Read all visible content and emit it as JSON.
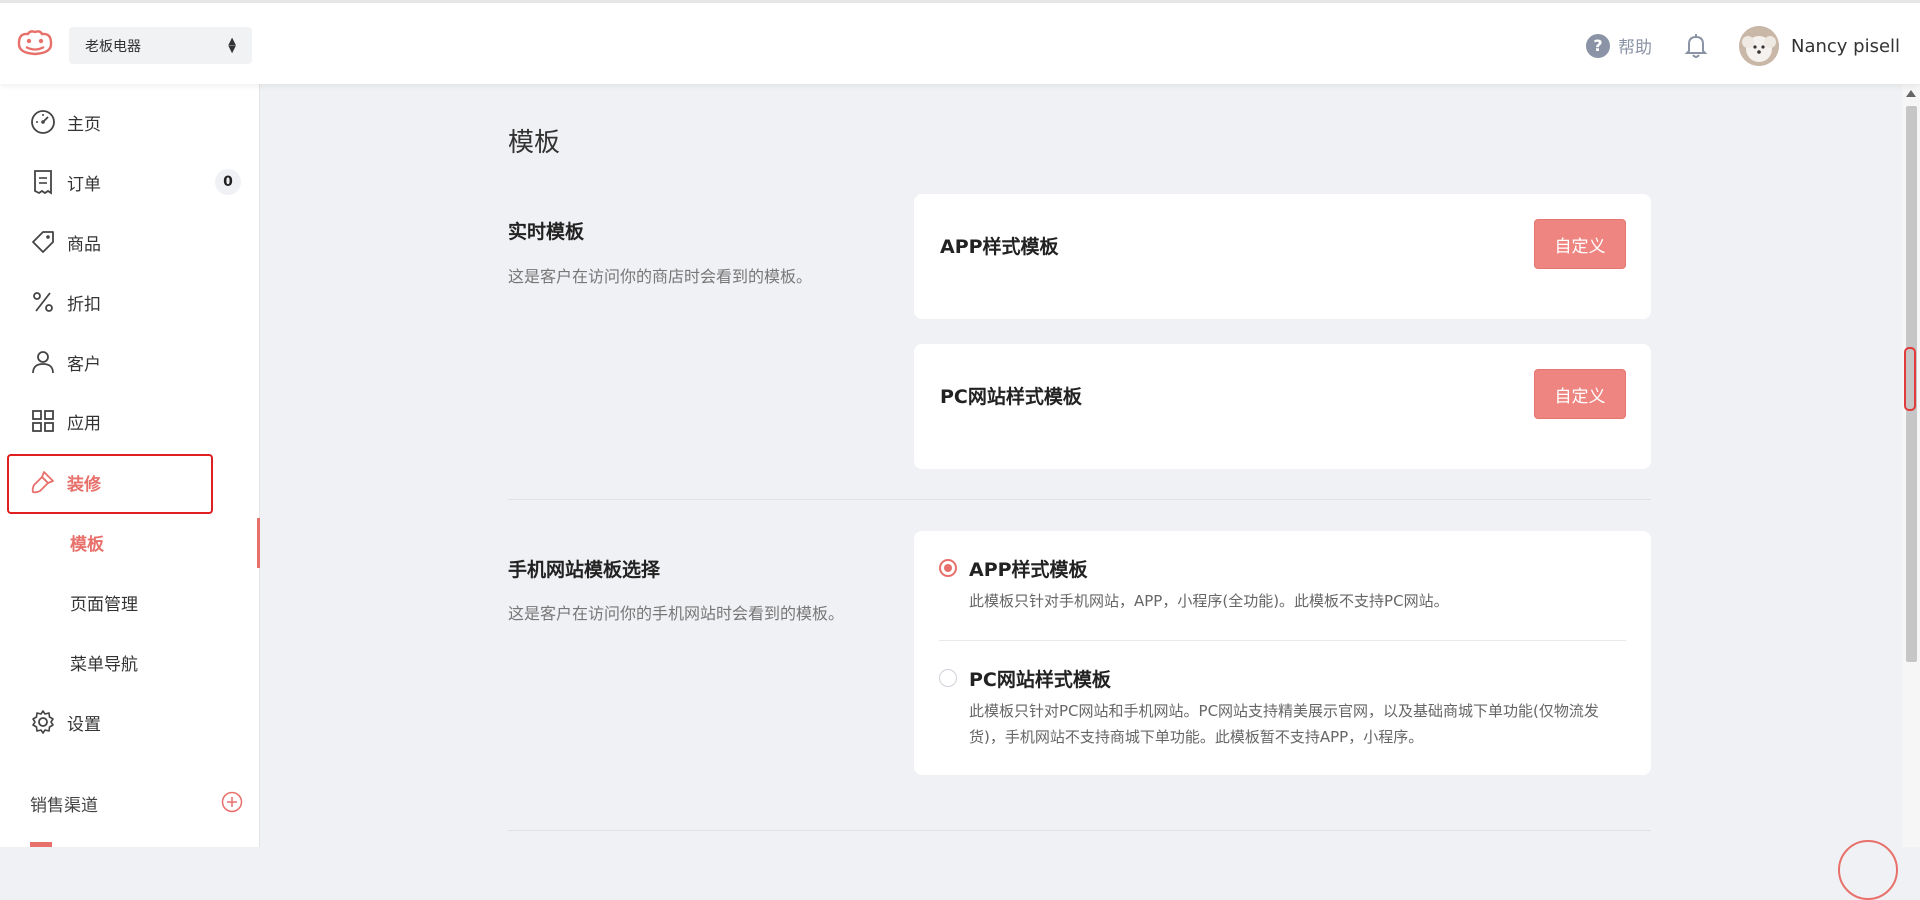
{
  "header": {
    "store_name": "老板电器",
    "help_label": "帮助",
    "user_name": "Nancy pisell"
  },
  "sidebar": {
    "items": [
      {
        "label": "主页",
        "icon": "dashboard-icon"
      },
      {
        "label": "订单",
        "icon": "order-icon",
        "badge": "0"
      },
      {
        "label": "商品",
        "icon": "tag-icon"
      },
      {
        "label": "折扣",
        "icon": "percent-icon"
      },
      {
        "label": "客户",
        "icon": "user-icon"
      },
      {
        "label": "应用",
        "icon": "apps-grid-icon"
      },
      {
        "label": "装修",
        "icon": "brush-icon"
      }
    ],
    "sub_items": [
      "模板",
      "页面管理",
      "菜单导航"
    ],
    "settings_label": "设置",
    "sales_channel_label": "销售渠道"
  },
  "main": {
    "page_title": "模板",
    "live_section": {
      "title": "实时模板",
      "description": "这是客户在访问你的商店时会看到的模板。",
      "cards": [
        {
          "title": "APP样式模板",
          "button": "自定义"
        },
        {
          "title": "PC网站样式模板",
          "button": "自定义"
        }
      ]
    },
    "mobile_section": {
      "title": "手机网站模板选择",
      "description": "这是客户在访问你的手机网站时会看到的模板。",
      "options": [
        {
          "title": "APP样式模板",
          "description": "此模板只针对手机网站，APP，小程序(全功能)。此模板不支持PC网站。",
          "selected": true
        },
        {
          "title": "PC网站样式模板",
          "description": "此模板只针对PC网站和手机网站。PC网站支持精美展示官网，以及基础商城下单功能(仅物流发货)，手机网站不支持商城下单功能。此模板暂不支持APP，小程序。",
          "selected": false
        }
      ]
    }
  },
  "colors": {
    "accent": "#e8706b",
    "button": "#ee8580",
    "highlight": "#e02020"
  }
}
